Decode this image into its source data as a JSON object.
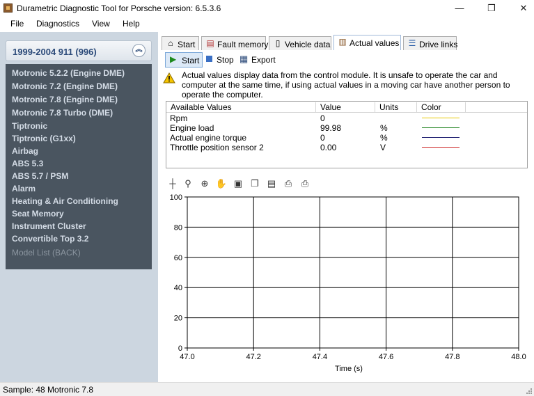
{
  "window": {
    "title": "Durametric Diagnostic Tool for Porsche version: 6.5.3.6"
  },
  "menu": [
    "File",
    "Diagnostics",
    "View",
    "Help"
  ],
  "sidebar": {
    "header": "1999-2004 911 (996)",
    "items": [
      "Motronic 5.2.2 (Engine DME)",
      "Motronic 7.2 (Engine DME)",
      "Motronic 7.8 (Engine DME)",
      "Motronic 7.8 Turbo (DME)",
      "Tiptronic",
      "Tiptronic (G1xx)",
      "Airbag",
      "ABS 5.3",
      "ABS 5.7 / PSM",
      "Alarm",
      "Heating & Air Conditioning",
      "Seat Memory",
      "Instrument Cluster",
      "Convertible Top 3.2"
    ],
    "back": "Model List (BACK)"
  },
  "tabs": [
    {
      "label": "Start",
      "icon": "home-icon"
    },
    {
      "label": "Fault memory",
      "icon": "document-icon"
    },
    {
      "label": "Vehicle data",
      "icon": "info-icon"
    },
    {
      "label": "Actual values",
      "icon": "bar-chart-icon"
    },
    {
      "label": "Drive links",
      "icon": "list-icon"
    }
  ],
  "toolbar": {
    "start": "Start",
    "stop": "Stop",
    "export": "Export"
  },
  "warning": "Actual values display data from the control module. It is unsafe to operate the car and computer at the same time, if using actual values in a moving car have another person to operate the computer.",
  "values_table": {
    "columns": [
      "Available Values",
      "Value",
      "Units",
      "Color"
    ],
    "rows": [
      {
        "name": "Rpm",
        "value": "0",
        "units": "",
        "color": "#e6c800"
      },
      {
        "name": "Engine load",
        "value": "99.98",
        "units": "%",
        "color": "#2e8b2e"
      },
      {
        "name": "Actual engine torque",
        "value": "0",
        "units": "%",
        "color": "#1a1a6e"
      },
      {
        "name": "Throttle position sensor 2",
        "value": "0.00",
        "units": "V",
        "color": "#cc2020"
      }
    ]
  },
  "chart_data": {
    "type": "line",
    "xlabel": "Time (s)",
    "ylabel": "",
    "xlim": [
      47.0,
      48.0
    ],
    "ylim": [
      0,
      100
    ],
    "x_ticks": [
      "47.0",
      "47.2",
      "47.4",
      "47.6",
      "47.8",
      "48.0"
    ],
    "y_ticks": [
      "0",
      "20",
      "40",
      "60",
      "80",
      "100"
    ],
    "grid": true,
    "series": []
  },
  "status": {
    "text": "Sample: 48  Motronic 7.8"
  }
}
